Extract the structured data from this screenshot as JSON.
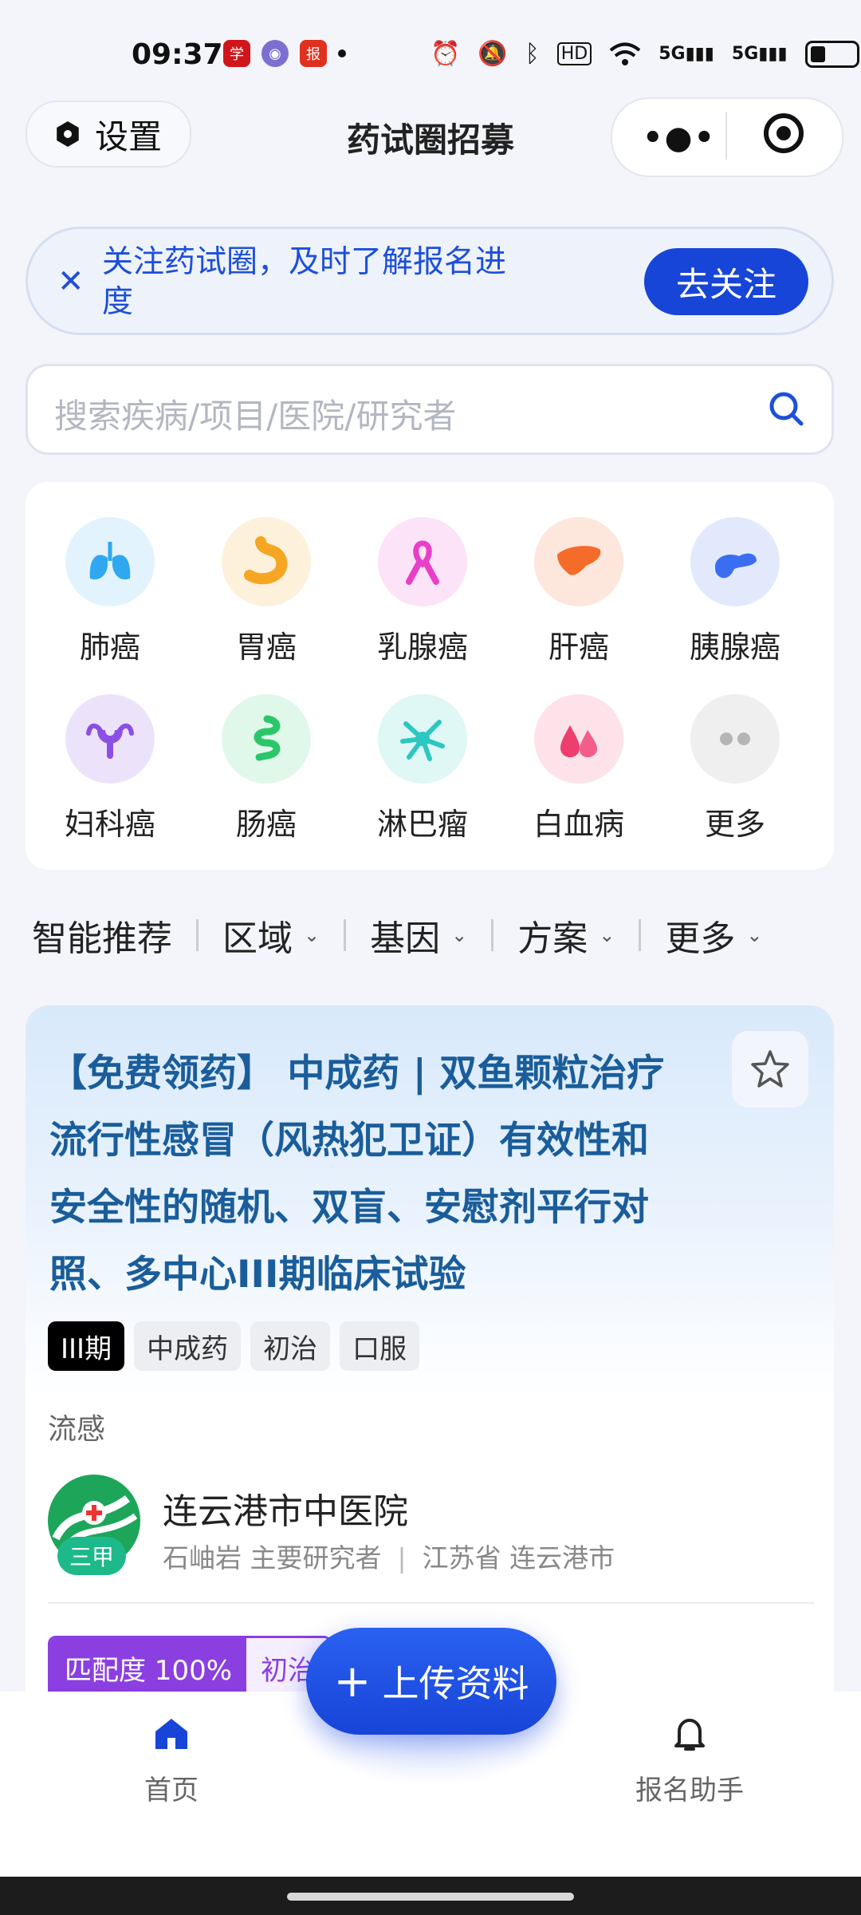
{
  "status_bar": {
    "time": "09:37",
    "network": "5G",
    "network2": "5G",
    "hd": "HD"
  },
  "header": {
    "settings_label": "设置",
    "title": "药试圈招募"
  },
  "follow_banner": {
    "text": "关注药试圈，及时了解报名进度",
    "button": "去关注"
  },
  "search": {
    "placeholder": "搜索疾病/项目/医院/研究者"
  },
  "categories": [
    {
      "label": "肺癌",
      "icon": "lungs-icon",
      "color": "#2fa8f0"
    },
    {
      "label": "胃癌",
      "icon": "stomach-icon",
      "color": "#f5a623"
    },
    {
      "label": "乳腺癌",
      "icon": "ribbon-icon",
      "color": "#e83ec8"
    },
    {
      "label": "肝癌",
      "icon": "liver-icon",
      "color": "#f56b2a"
    },
    {
      "label": "胰腺癌",
      "icon": "pancreas-icon",
      "color": "#3a6df0"
    },
    {
      "label": "妇科癌",
      "icon": "uterus-icon",
      "color": "#8b4fe6"
    },
    {
      "label": "肠癌",
      "icon": "intestine-icon",
      "color": "#2bc66a"
    },
    {
      "label": "淋巴瘤",
      "icon": "lymph-icon",
      "color": "#2cc7c0"
    },
    {
      "label": "白血病",
      "icon": "blood-drops-icon",
      "color": "#ee3e6e"
    },
    {
      "label": "更多",
      "icon": "more-dots-icon",
      "color": "#b5b5b5"
    }
  ],
  "filters": {
    "recommend": "智能推荐",
    "region": "区域",
    "gene": "基因",
    "plan": "方案",
    "more": "更多"
  },
  "trial": {
    "title": "【免费领药】 中成药 | 双鱼颗粒治疗流行性感冒（风热犯卫证）有效性和安全性的随机、双盲、安慰剂平行对照、多中心III期临床试验",
    "tags": [
      "III期",
      "中成药",
      "初治",
      "口服"
    ],
    "disease": "流感",
    "hospital": "连云港市中医院",
    "grade": "三甲",
    "researcher": "石岫岩 主要研究者",
    "location": "江苏省 连云港市",
    "match": "匹配度 100%",
    "match_tag": "初治"
  },
  "upload_button": "上传资料",
  "nav": {
    "home": "首页",
    "assistant": "报名助手"
  },
  "colors": {
    "primary": "#1745d8",
    "title_blue": "#1a5d9a",
    "match_purple": "#8b3fe0"
  }
}
